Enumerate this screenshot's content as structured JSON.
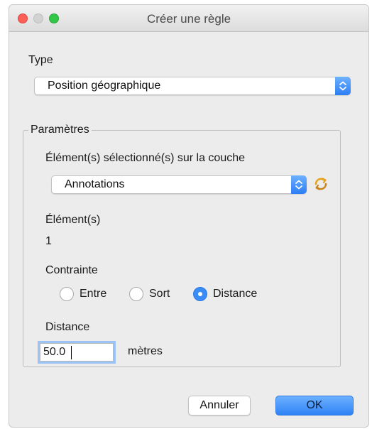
{
  "window": {
    "title": "Créer une règle"
  },
  "type_section": {
    "label": "Type",
    "selected": "Position géographique"
  },
  "parameters": {
    "legend": "Paramètres",
    "layer_label": "Élément(s) sélectionné(s) sur la couche",
    "layer_selected": "Annotations",
    "elements_label": "Élément(s)",
    "elements_count": "1",
    "constraint_label": "Contrainte",
    "constraint_options": [
      "Entre",
      "Sort",
      "Distance"
    ],
    "constraint_selected": "Distance",
    "distance_label": "Distance",
    "distance_value": "50.0",
    "distance_unit": "mètres"
  },
  "buttons": {
    "cancel": "Annuler",
    "ok": "OK"
  },
  "colors": {
    "accent": "#3a8cf8",
    "close": "#fc5f57",
    "maximize": "#33c748",
    "refresh_icon": "#e2a21f"
  },
  "icons": [
    "close-icon",
    "minimize-icon",
    "maximize-icon",
    "chevron-updown-icon",
    "refresh-icon",
    "radio-icon"
  ]
}
